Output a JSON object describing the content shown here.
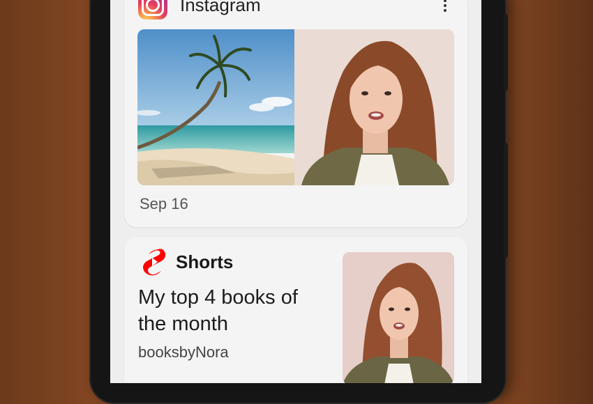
{
  "instagram_card": {
    "app_name": "Instagram",
    "date": "Sep 16",
    "more_icon": "more-vertical-icon"
  },
  "shorts_card": {
    "app_name": "Shorts",
    "title": "My top 4 books of the month",
    "channel": "booksbyNora"
  },
  "colors": {
    "screen_bg": "#eeeeee",
    "card_bg": "#f4f4f4",
    "shorts_red": "#ff0000",
    "text": "#222222"
  }
}
